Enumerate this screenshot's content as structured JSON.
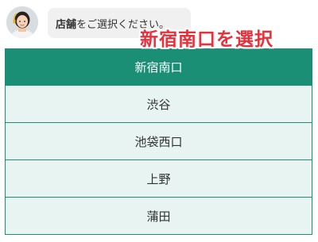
{
  "chat": {
    "bubble_bold": "店舗",
    "bubble_rest": "をご選択ください。"
  },
  "annotation": {
    "text": "新宿南口を選択",
    "color": "#e8303b"
  },
  "stores": {
    "items": [
      {
        "label": "新宿南口",
        "selected": true
      },
      {
        "label": "渋谷",
        "selected": false
      },
      {
        "label": "池袋西口",
        "selected": false
      },
      {
        "label": "上野",
        "selected": false
      },
      {
        "label": "蒲田",
        "selected": false
      }
    ]
  },
  "colors": {
    "accent": "#1b8f75",
    "row_background": "#e8f4f1",
    "bubble_background": "#f0f0f0"
  },
  "icons": {
    "avatar": "operator-avatar"
  }
}
